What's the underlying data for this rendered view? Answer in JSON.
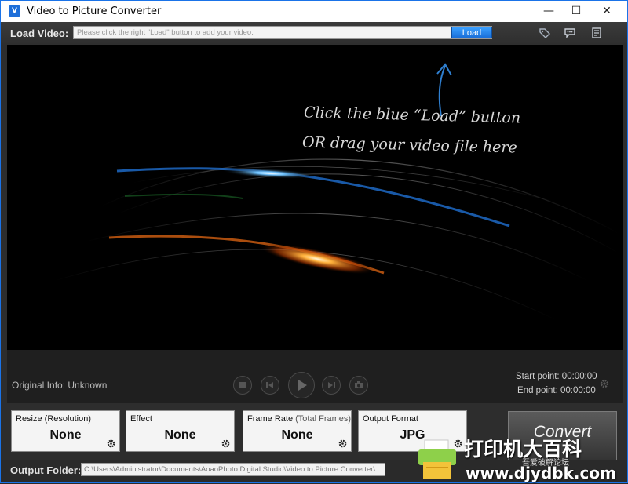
{
  "window": {
    "app_icon_text": "V",
    "title": "Video to Picture Converter",
    "minimize": "—",
    "maximize": "☐",
    "close": "✕"
  },
  "load": {
    "label": "Load Video:",
    "placeholder": "Please click the right \"Load\" button to add your video.",
    "button": "Load"
  },
  "toolbar_icons": [
    "tag-icon",
    "chat-icon",
    "notes-icon"
  ],
  "stage": {
    "hint_line1": "Click the blue “Load” button",
    "hint_line2": "OR drag your video file here"
  },
  "player": {
    "original_info": "Original Info: Unknown",
    "start_point": "Start point: 00:00:00",
    "end_point": "End point: 00:00:00"
  },
  "panels": [
    {
      "label": "Resize (Resolution)",
      "label_sub": "",
      "value": "None"
    },
    {
      "label": "Effect",
      "label_sub": "",
      "value": "None"
    },
    {
      "label": "Frame Rate ",
      "label_sub": "(Total Frames)",
      "value": "None"
    },
    {
      "label": "Output Format",
      "label_sub": "",
      "value": "JPG"
    }
  ],
  "convert_label": "Convert",
  "output": {
    "label": "Output Folder:",
    "path": "C:\\Users\\Administrator\\Documents\\AoaoPhoto Digital Studio\\Video to Picture Converter\\"
  },
  "watermark": {
    "line1": "打印机大百科",
    "line2": "吾爱破解论坛",
    "line3": "www.djydbk.com"
  },
  "colors": {
    "accent_blue": "#1a6fd8",
    "background": "#2d2d2d"
  }
}
